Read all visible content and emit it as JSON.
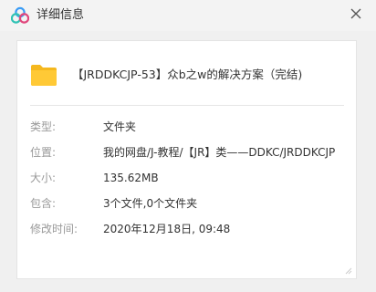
{
  "window": {
    "title": "详细信息",
    "close_icon": "close-icon",
    "logo_icon": "cloud-logo-icon"
  },
  "file": {
    "icon": "folder-icon",
    "icon_color": "#ffc936",
    "name": "【JRDDKCJP-53】众b之w的解决方案（完结)"
  },
  "details": [
    {
      "label": "类型:",
      "value": "文件夹"
    },
    {
      "label": "位置:",
      "value": "我的网盘/J-教程/【JR】类——DDKC/JRDDKCJP"
    },
    {
      "label": "大小:",
      "value": "135.62MB"
    },
    {
      "label": "包含:",
      "value": "3个文件,0个文件夹"
    },
    {
      "label": "修改时间:",
      "value": "2020年12月18日, 09:48"
    }
  ]
}
